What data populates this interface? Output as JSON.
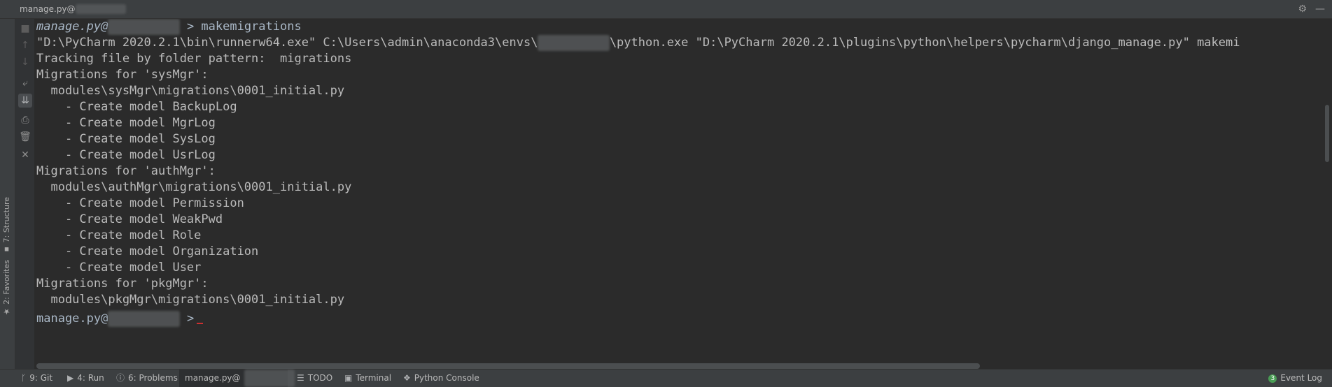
{
  "titlebar": {
    "title_prefix": "manage.py@",
    "title_blurred": "bms_django"
  },
  "toolbar": {
    "icons": [
      "stop-icon",
      "scroll-up-icon",
      "scroll-down-icon",
      "soft-wrap-icon",
      "scroll-to-end-icon",
      "print-icon",
      "trash-icon",
      "close-icon"
    ]
  },
  "left_strip": {
    "structure": "7: Structure",
    "favorites": "2: Favorites"
  },
  "console": {
    "prompt_label": "manage.py@",
    "prompt_blurred": "bms_django",
    "command": " > makemigrations",
    "run_line_1": "\"D:\\PyCharm 2020.2.1\\bin\\runnerw64.exe\" C:\\Users\\admin\\anaconda3\\envs\\",
    "run_line_blurred": "bms_django",
    "run_line_2": "\\python.exe \"D:\\PyCharm 2020.2.1\\plugins\\python\\helpers\\pycharm\\django_manage.py\" makemi",
    "lines": [
      "Tracking file by folder pattern:  migrations",
      "Migrations for 'sysMgr':",
      "  modules\\sysMgr\\migrations\\0001_initial.py",
      "    - Create model BackupLog",
      "    - Create model MgrLog",
      "    - Create model SysLog",
      "    - Create model UsrLog",
      "Migrations for 'authMgr':",
      "  modules\\authMgr\\migrations\\0001_initial.py",
      "    - Create model Permission",
      "    - Create model WeakPwd",
      "    - Create model Role",
      "    - Create model Organization",
      "    - Create model User",
      "Migrations for 'pkgMgr':",
      "  modules\\pkgMgr\\migrations\\0001_initial.py"
    ],
    "end_prompt_label": "manage.py@",
    "end_prompt_blurred": "bms_django",
    "end_prompt_suffix": " >"
  },
  "statusbar": {
    "git": "9: Git",
    "run": "4: Run",
    "problems": "6: Problems",
    "manage_prefix": "manage.py@",
    "manage_blurred": "bms_django",
    "todo": "TODO",
    "terminal": "Terminal",
    "python_console": "Python Console",
    "event_log": "Event Log",
    "event_count": "3"
  }
}
